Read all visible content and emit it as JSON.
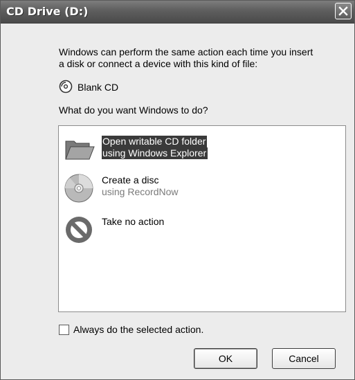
{
  "window": {
    "title": "CD Drive (D:)"
  },
  "intro": {
    "line1": "Windows can perform the same action each time you insert",
    "line2": "a disk or connect a device with this kind of file:"
  },
  "content_type": {
    "label": "Blank CD",
    "icon": "cd-icon"
  },
  "question": "What do you want Windows to do?",
  "actions": [
    {
      "line1": "Open writable CD folder",
      "line2": "using Windows Explorer",
      "icon": "folder-icon",
      "selected": true
    },
    {
      "line1": "Create a disc",
      "line2": "using RecordNow",
      "icon": "disc-icon",
      "selected": false
    },
    {
      "line1": "Take no action",
      "line2": "",
      "icon": "no-action-icon",
      "selected": false
    }
  ],
  "always": {
    "label": "Always do the selected action.",
    "checked": false
  },
  "buttons": {
    "ok": "OK",
    "cancel": "Cancel"
  },
  "colors": {
    "titlebar": "#5e5e5e",
    "selection": "#3a3a3a",
    "dialog_bg": "#ececec"
  }
}
